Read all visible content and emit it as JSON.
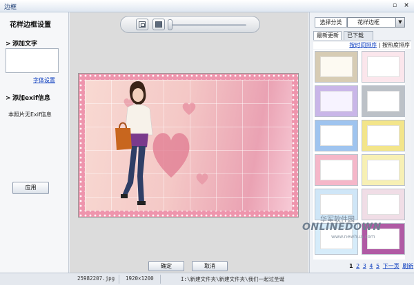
{
  "window": {
    "title": "边框",
    "max_glyph": "▫",
    "close_glyph": "×"
  },
  "left_panel": {
    "heading": "花样边框设置",
    "add_text": {
      "arrow": ">",
      "label": "添加文字",
      "font_link": "字体设置"
    },
    "add_exif": {
      "arrow": ">",
      "label": "添加exif信息",
      "no_exif": "本照片无Exif信息"
    },
    "apply_label": "应用"
  },
  "toolbar": {
    "fit_icon": "fit-window-icon",
    "fullscreen_icon": "fullscreen-icon",
    "zoom_level": 0.0
  },
  "preview": {
    "image": "pink-heart-frame-photo"
  },
  "actions": {
    "ok_label": "确定",
    "cancel_label": "取消"
  },
  "right_panel": {
    "category_label": "选择分类",
    "category_value": "花样边框",
    "dropdown_glyph": "▼",
    "tabs": [
      {
        "label": "最新更新",
        "active": true
      },
      {
        "label": "已下载",
        "active": false
      }
    ],
    "sort": {
      "by_time": "按时间排序",
      "divider": " | ",
      "by_hot": "按热度排序"
    },
    "thumbnails": [
      {
        "color": "#d7ccb4",
        "hole": "#fdfaf2"
      },
      {
        "color": "#fbe6ec",
        "hole": "#ffffff"
      },
      {
        "color": "#c9b6e8",
        "hole": "#f7f3ff"
      },
      {
        "color": "#bcc1c7",
        "hole": "#ffffff"
      },
      {
        "color": "#9fc4ef",
        "hole": "#ffffff"
      },
      {
        "color": "#f3e58a",
        "hole": "#ffffff"
      },
      {
        "color": "#f5b7c9",
        "hole": "#ffffff"
      },
      {
        "color": "#f7f0b4",
        "hole": "#ffffff"
      },
      {
        "color": "#cfe6f7",
        "hole": "#ffffff"
      },
      {
        "color": "#f0dde6",
        "hole": "#ffffff"
      },
      {
        "color": "#d6ecfa",
        "hole": "#ffffff"
      },
      {
        "color": "#b05aa4",
        "hole": "#ffffff"
      }
    ],
    "pager": {
      "current": "1",
      "pages": [
        "2",
        "3",
        "4",
        "5"
      ],
      "next": "下一页",
      "refresh": "刷新"
    }
  },
  "status_bar": {
    "filename": "25982207.jpg",
    "dimensions": "1920×1200",
    "path": "I:\\新建文件夹\\新建文件夹\\我们一起过圣诞"
  },
  "watermark": {
    "cn": "华军软件园",
    "en": "ONLINEDOWN",
    "url": "www.newhua.com"
  }
}
